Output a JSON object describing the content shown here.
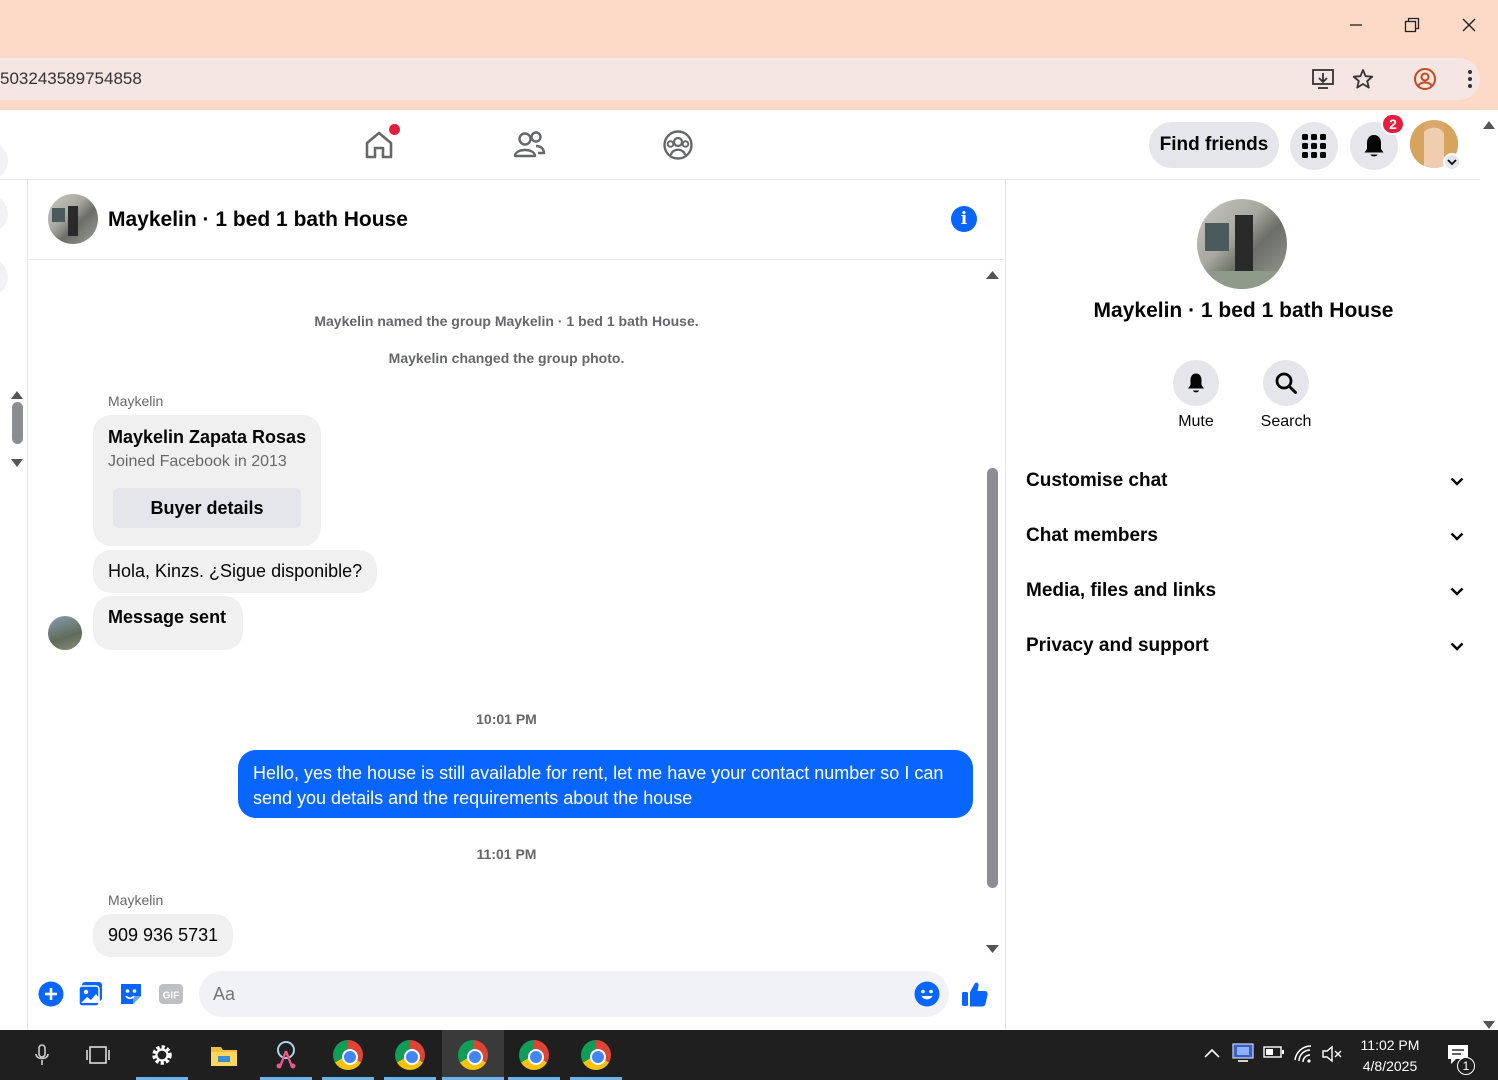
{
  "browser": {
    "url_fragment": "503243589754858",
    "window_controls": {
      "minimize": "minimize-icon",
      "restore": "restore-icon",
      "close": "close-icon"
    }
  },
  "facebook_nav": {
    "find_friends_label": "Find friends",
    "notification_count": "2"
  },
  "chat": {
    "title": "Maykelin · 1 bed 1 bath House",
    "system_messages": [
      "Maykelin named the group Maykelin · 1 bed 1 bath House.",
      "Maykelin changed the group photo."
    ],
    "first_sender": "Maykelin",
    "buyer_card": {
      "name": "Maykelin Zapata Rosas",
      "joined": "Joined Facebook in 2013",
      "button_label": "Buyer details"
    },
    "buyer_message": "Hola, Kinzs. ¿Sigue disponible?",
    "status_message": "Message sent",
    "timestamp_1": "10:01 PM",
    "outgoing_message": "Hello, yes the house is still available for rent, let me have your contact number so I can send you details and the requirements about the house",
    "timestamp_2": "11:01 PM",
    "second_sender": "Maykelin",
    "phone_message": "909 936 5731",
    "composer_placeholder": "Aa"
  },
  "right_panel": {
    "name": "Maykelin · 1 bed 1 bath House",
    "actions": [
      {
        "label": "Mute",
        "icon": "bell-icon"
      },
      {
        "label": "Search",
        "icon": "search-icon"
      }
    ],
    "sections": [
      "Customise chat",
      "Chat members",
      "Media, files and links",
      "Privacy and support"
    ]
  },
  "taskbar": {
    "time": "11:02 PM",
    "date": "4/8/2025",
    "notification_count": "1"
  },
  "colors": {
    "accent": "#0866ff",
    "titlebar": "#fdd9c7",
    "badge": "#e41e3f"
  }
}
